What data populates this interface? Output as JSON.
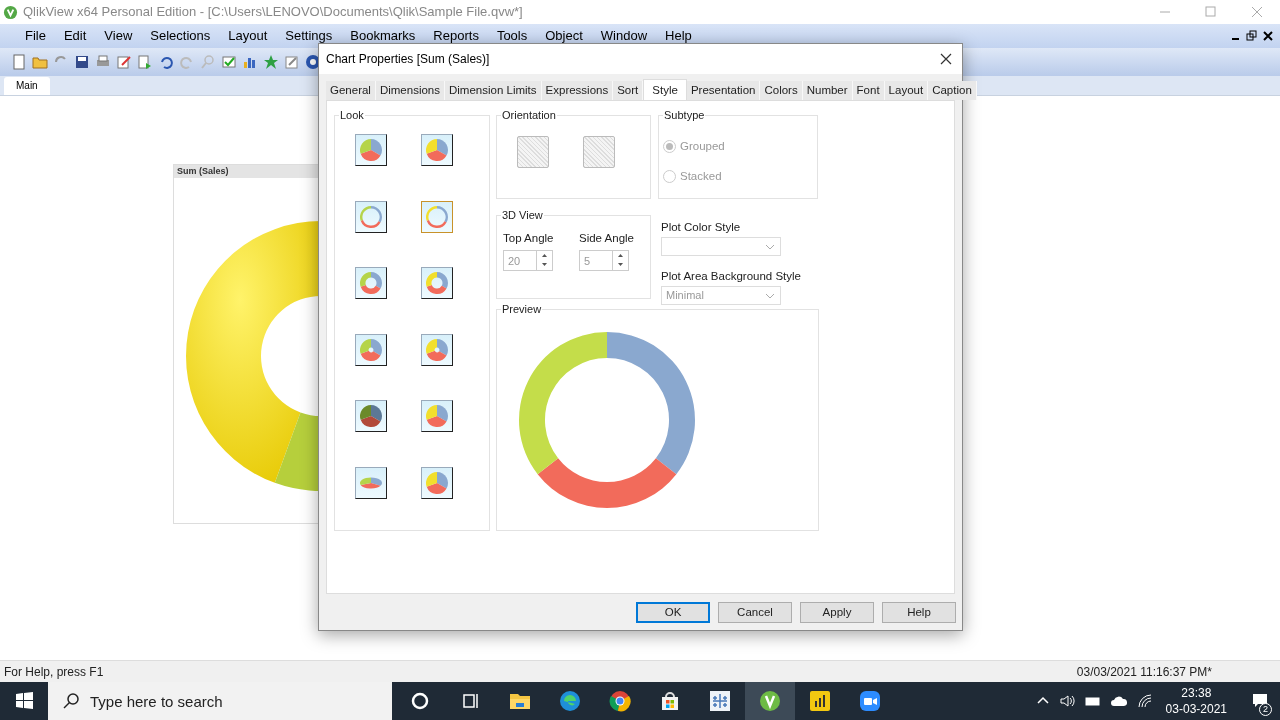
{
  "app": {
    "title": "QlikView x64 Personal Edition - [C:\\Users\\LENOVO\\Documents\\Qlik\\Sample File.qvw*]"
  },
  "menu": [
    "File",
    "Edit",
    "View",
    "Selections",
    "Layout",
    "Settings",
    "Bookmarks",
    "Reports",
    "Tools",
    "Object",
    "Window",
    "Help"
  ],
  "sheet_tabs": [
    {
      "label": "Main",
      "selected": true
    }
  ],
  "sheet_object": {
    "caption": "Sum (Sales)"
  },
  "dialog": {
    "title": "Chart Properties [Sum (Sales)]",
    "tabs": [
      {
        "label": "General",
        "selected": false
      },
      {
        "label": "Dimensions",
        "selected": false
      },
      {
        "label": "Dimension Limits",
        "selected": false
      },
      {
        "label": "Expressions",
        "selected": false
      },
      {
        "label": "Sort",
        "selected": false
      },
      {
        "label": "Style",
        "selected": true
      },
      {
        "label": "Presentation",
        "selected": false
      },
      {
        "label": "Colors",
        "selected": false
      },
      {
        "label": "Number",
        "selected": false
      },
      {
        "label": "Font",
        "selected": false
      },
      {
        "label": "Layout",
        "selected": false
      },
      {
        "label": "Caption",
        "selected": false
      }
    ],
    "look": {
      "label": "Look",
      "styles": [
        {
          "kind": "pie",
          "selected": false
        },
        {
          "kind": "pie",
          "selected": false
        },
        {
          "kind": "ring",
          "selected": false
        },
        {
          "kind": "ring",
          "selected": true
        },
        {
          "kind": "donut",
          "selected": false
        },
        {
          "kind": "donut",
          "selected": false
        },
        {
          "kind": "hole",
          "selected": false
        },
        {
          "kind": "hole",
          "selected": false
        },
        {
          "kind": "dark",
          "selected": false
        },
        {
          "kind": "pie",
          "selected": false
        },
        {
          "kind": "tilted",
          "selected": false
        },
        {
          "kind": "pie",
          "selected": false
        }
      ]
    },
    "orientation": {
      "label": "Orientation"
    },
    "subtype": {
      "label": "Subtype",
      "options": [
        {
          "label": "Grouped",
          "selected": true,
          "disabled": true
        },
        {
          "label": "Stacked",
          "selected": false,
          "disabled": true
        }
      ]
    },
    "view_3d": {
      "label": "3D View",
      "fields": [
        {
          "label": "Top Angle",
          "value": "20"
        },
        {
          "label": "Side Angle",
          "value": "5"
        }
      ]
    },
    "plot_color_style": {
      "label": "Plot Color Style"
    },
    "plot_area_background_style": {
      "label": "Plot Area Background Style",
      "value": "Minimal"
    },
    "preview": {
      "label": "Preview"
    },
    "buttons": [
      {
        "label": "OK",
        "default": true
      },
      {
        "label": "Cancel",
        "default": false
      },
      {
        "label": "Apply",
        "default": false
      },
      {
        "label": "Help",
        "default": false
      }
    ]
  },
  "status_bar": {
    "help": "For Help, press F1",
    "timestamp": "03/03/2021 11:16:37 PM*"
  },
  "taskbar": {
    "search_placeholder": "Type here to search",
    "apps": [
      {
        "kind": "cortana",
        "active": false
      },
      {
        "kind": "taskview",
        "active": false
      },
      {
        "kind": "folder",
        "active": false
      },
      {
        "kind": "edge",
        "active": false
      },
      {
        "kind": "chrome",
        "active": false
      },
      {
        "kind": "store",
        "active": false
      },
      {
        "kind": "tableau",
        "active": false
      },
      {
        "kind": "qlik",
        "active": true
      },
      {
        "kind": "powerbi",
        "active": false
      },
      {
        "kind": "zoom",
        "active": false
      }
    ],
    "time": "23:38",
    "date": "03-03-2021",
    "notifications": "2"
  }
}
